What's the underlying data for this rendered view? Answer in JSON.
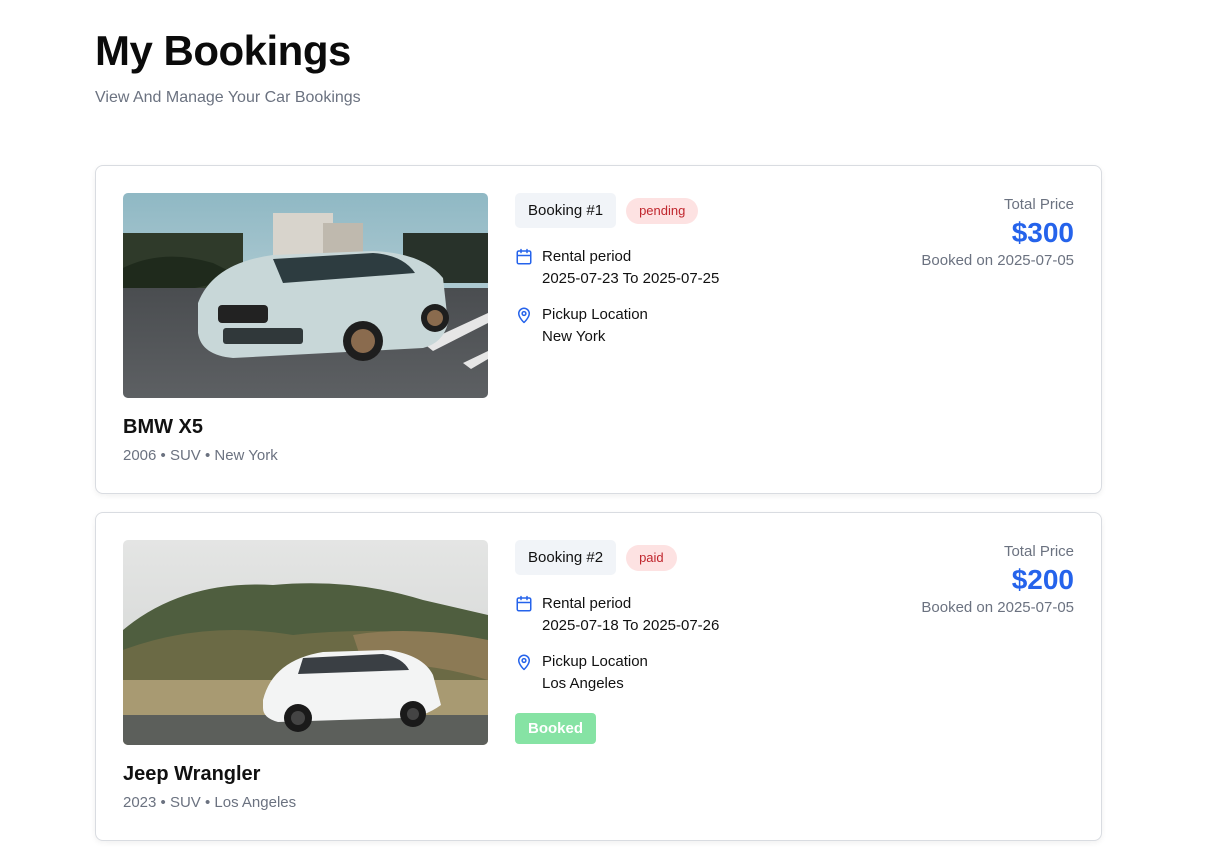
{
  "header": {
    "title": "My Bookings",
    "subtitle": "View And Manage Your Car Bookings"
  },
  "bookings": [
    {
      "car_name": "BMW X5",
      "car_meta": "2006 • SUV • New York",
      "booking_label": "Booking #1",
      "status": "pending",
      "rental_label": "Rental period",
      "rental_dates": "2025-07-23 To 2025-07-25",
      "pickup_label": "Pickup Location",
      "pickup_location": "New York",
      "price_label": "Total Price",
      "price": "$300",
      "booked_on": "Booked on 2025-07-05",
      "image_icon": "car-photo-bmw"
    },
    {
      "car_name": "Jeep Wrangler",
      "car_meta": "2023 • SUV • Los Angeles",
      "booking_label": "Booking #2",
      "status": "paid",
      "rental_label": "Rental period",
      "rental_dates": "2025-07-18 To 2025-07-26",
      "pickup_label": "Pickup Location",
      "pickup_location": "Los Angeles",
      "action_label": "Booked",
      "price_label": "Total Price",
      "price": "$200",
      "booked_on": "Booked on 2025-07-05",
      "image_icon": "car-photo-white-sedan"
    }
  ],
  "colors": {
    "accent": "#2563eb",
    "status_bg": "#fde2e2",
    "status_text": "#c0262d",
    "booked_button": "#86e3a4",
    "muted_text": "#6b7280"
  },
  "icons": {
    "calendar": "calendar-icon",
    "location": "map-pin-icon"
  }
}
